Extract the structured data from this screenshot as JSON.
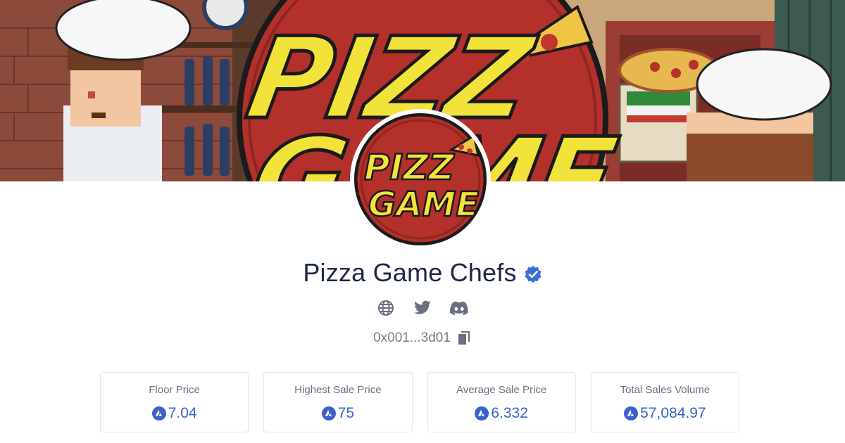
{
  "collection": {
    "name": "Pizza Game Chefs",
    "verified": true,
    "address": "0x001...3d01",
    "banner_logo_line1": "PIZZ",
    "banner_logo_line2": "GAME",
    "avatar_logo_line1": "PIZZ",
    "avatar_logo_line2": "GAME"
  },
  "social": {
    "links": [
      {
        "icon": "globe-icon"
      },
      {
        "icon": "twitter-icon"
      },
      {
        "icon": "discord-icon"
      }
    ]
  },
  "stats": [
    {
      "label": "Floor Price",
      "value": "7.04",
      "currency_icon": "avax-icon"
    },
    {
      "label": "Highest Sale Price",
      "value": "75",
      "currency_icon": "avax-icon"
    },
    {
      "label": "Average Sale Price",
      "value": "6.332",
      "currency_icon": "avax-icon"
    },
    {
      "label": "Total Sales Volume",
      "value": "57,084.97",
      "currency_icon": "avax-icon"
    }
  ],
  "colors": {
    "title": "#20264a",
    "accent": "#3a63c9",
    "verified": "#3a6fd8",
    "muted": "#7a7e8c",
    "logo_red": "#b3302b",
    "logo_yellow": "#f2e33a"
  }
}
